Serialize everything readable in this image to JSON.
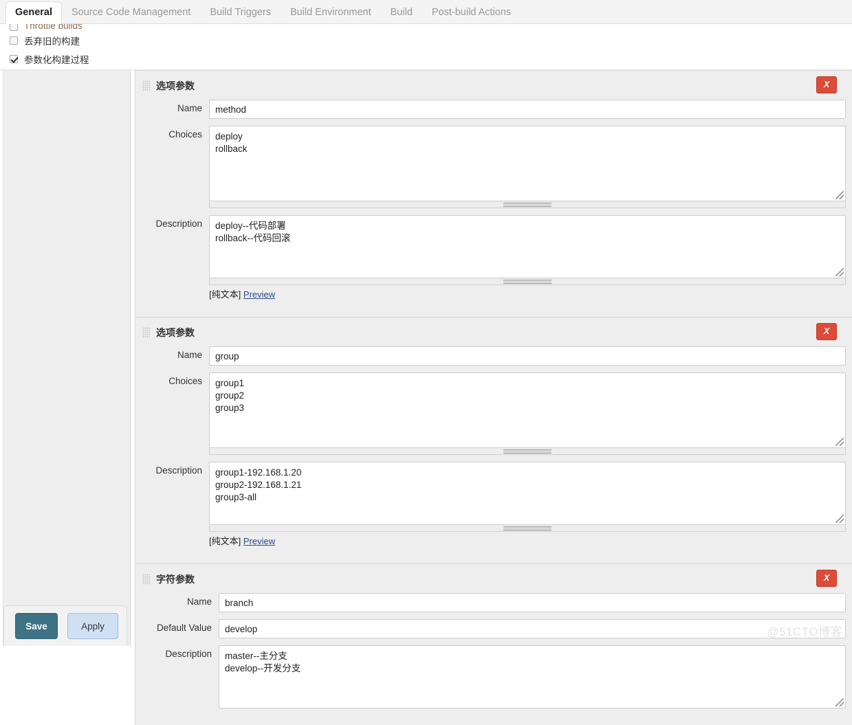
{
  "tabs": [
    {
      "label": "General",
      "active": true
    },
    {
      "label": "Source Code Management",
      "active": false
    },
    {
      "label": "Build Triggers",
      "active": false
    },
    {
      "label": "Build Environment",
      "active": false
    },
    {
      "label": "Build",
      "active": false
    },
    {
      "label": "Post-build Actions",
      "active": false
    }
  ],
  "top_options": [
    {
      "label": "Throttle builds",
      "checked": false
    },
    {
      "label": "丢弃旧的构建",
      "checked": false
    },
    {
      "label": "参数化构建过程",
      "checked": true
    }
  ],
  "labels": {
    "name": "Name",
    "choices": "Choices",
    "description": "Description",
    "default_value": "Default Value",
    "plaintext": "[纯文本]",
    "preview": "Preview",
    "delete": "X"
  },
  "parameters": [
    {
      "type_title": "选项参数",
      "name_value": "method",
      "choices_value": "deploy\nrollback",
      "description_value": "deploy--代码部署\nrollback--代码回滚"
    },
    {
      "type_title": "选项参数",
      "name_value": "group",
      "choices_value": "group1\ngroup2\ngroup3",
      "description_value": "group1-192.168.1.20\ngroup2-192.168.1.21\ngroup3-all"
    },
    {
      "type_title": "字符参数",
      "name_value": "branch",
      "default_value": "develop",
      "description_value": "master--主分支\ndevelop--开发分支"
    }
  ],
  "footer": {
    "save_label": "Save",
    "apply_label": "Apply"
  },
  "watermark": "@51CTO博客",
  "colors": {
    "accent_save": "#3e7285",
    "accent_apply": "#cfe0f3",
    "delete_red": "#dd4b39",
    "link_blue": "#2a4b8d",
    "panel_bg": "#eeeeee"
  }
}
